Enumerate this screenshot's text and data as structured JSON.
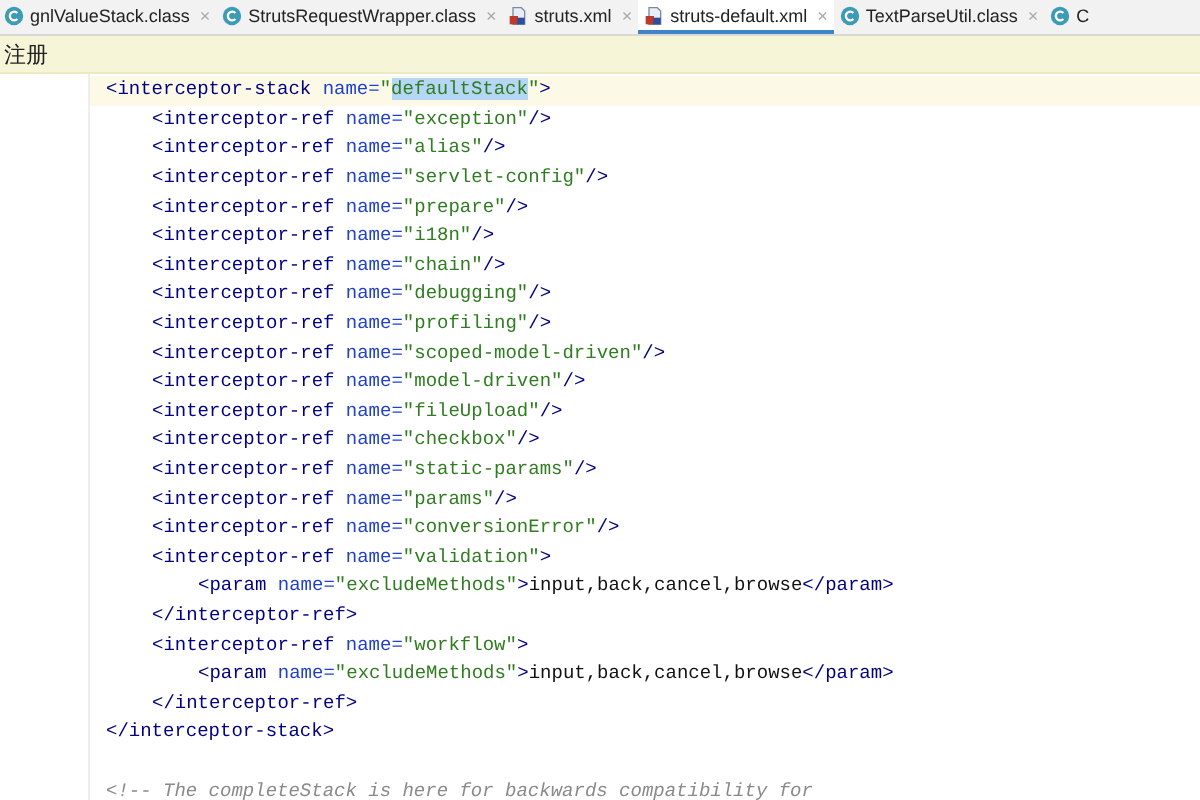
{
  "tabs": [
    {
      "label": "gnlValueStack.class",
      "kind": "class",
      "close": "×",
      "selected": false
    },
    {
      "label": "StrutsRequestWrapper.class",
      "kind": "class",
      "close": "×",
      "selected": false
    },
    {
      "label": "struts.xml",
      "kind": "xml",
      "close": "×",
      "selected": false
    },
    {
      "label": "struts-default.xml",
      "kind": "xml",
      "close": "×",
      "selected": true
    },
    {
      "label": "TextParseUtil.class",
      "kind": "class",
      "close": "×",
      "selected": false
    },
    {
      "label": "C",
      "kind": "class",
      "selected": false
    }
  ],
  "notice": {
    "text": "注册"
  },
  "code": [
    {
      "kind": "element",
      "current": true,
      "tokens": [
        {
          "kind": "tag",
          "text": "<interceptor-stack"
        },
        {
          "kind": "attr",
          "text": "name="
        },
        {
          "kind": "value",
          "text": "\""
        },
        {
          "kind": "value",
          "text": "defaultStack",
          "highlighted": true
        },
        {
          "kind": "value",
          "text": "\""
        },
        {
          "kind": "tag",
          "text": ">"
        }
      ],
      "children": [
        {
          "tokens": [
            {
              "kind": "tag",
              "text": "<interceptor-ref"
            },
            {
              "kind": "attr",
              "text": "name="
            },
            {
              "kind": "value",
              "text": "\"exception\""
            },
            {
              "kind": "tag",
              "text": "/>"
            }
          ]
        },
        {
          "tokens": [
            {
              "kind": "tag",
              "text": "<interceptor-ref"
            },
            {
              "kind": "attr",
              "text": "name="
            },
            {
              "kind": "value",
              "text": "\"alias\""
            },
            {
              "kind": "tag",
              "text": "/>"
            }
          ]
        },
        {
          "tokens": [
            {
              "kind": "tag",
              "text": "<interceptor-ref"
            },
            {
              "kind": "attr",
              "text": "name="
            },
            {
              "kind": "value",
              "text": "\"servlet-config\""
            },
            {
              "kind": "tag",
              "text": "/>"
            }
          ]
        },
        {
          "tokens": [
            {
              "kind": "tag",
              "text": "<interceptor-ref"
            },
            {
              "kind": "attr",
              "text": "name="
            },
            {
              "kind": "value",
              "text": "\"prepare\""
            },
            {
              "kind": "tag",
              "text": "/>"
            }
          ]
        },
        {
          "tokens": [
            {
              "kind": "tag",
              "text": "<interceptor-ref"
            },
            {
              "kind": "attr",
              "text": "name="
            },
            {
              "kind": "value",
              "text": "\"i18n\""
            },
            {
              "kind": "tag",
              "text": "/>"
            }
          ]
        },
        {
          "tokens": [
            {
              "kind": "tag",
              "text": "<interceptor-ref"
            },
            {
              "kind": "attr",
              "text": "name="
            },
            {
              "kind": "value",
              "text": "\"chain\""
            },
            {
              "kind": "tag",
              "text": "/>"
            }
          ]
        },
        {
          "tokens": [
            {
              "kind": "tag",
              "text": "<interceptor-ref"
            },
            {
              "kind": "attr",
              "text": "name="
            },
            {
              "kind": "value",
              "text": "\"debugging\""
            },
            {
              "kind": "tag",
              "text": "/>"
            }
          ]
        },
        {
          "tokens": [
            {
              "kind": "tag",
              "text": "<interceptor-ref"
            },
            {
              "kind": "attr",
              "text": "name="
            },
            {
              "kind": "value",
              "text": "\"profiling\""
            },
            {
              "kind": "tag",
              "text": "/>"
            }
          ]
        },
        {
          "tokens": [
            {
              "kind": "tag",
              "text": "<interceptor-ref"
            },
            {
              "kind": "attr",
              "text": "name="
            },
            {
              "kind": "value",
              "text": "\"scoped-model-driven\""
            },
            {
              "kind": "tag",
              "text": "/>"
            }
          ]
        },
        {
          "tokens": [
            {
              "kind": "tag",
              "text": "<interceptor-ref"
            },
            {
              "kind": "attr",
              "text": "name="
            },
            {
              "kind": "value",
              "text": "\"model-driven\""
            },
            {
              "kind": "tag",
              "text": "/>"
            }
          ]
        },
        {
          "tokens": [
            {
              "kind": "tag",
              "text": "<interceptor-ref"
            },
            {
              "kind": "attr",
              "text": "name="
            },
            {
              "kind": "value",
              "text": "\"fileUpload\""
            },
            {
              "kind": "tag",
              "text": "/>"
            }
          ]
        },
        {
          "tokens": [
            {
              "kind": "tag",
              "text": "<interceptor-ref"
            },
            {
              "kind": "attr",
              "text": "name="
            },
            {
              "kind": "value",
              "text": "\"checkbox\""
            },
            {
              "kind": "tag",
              "text": "/>"
            }
          ]
        },
        {
          "tokens": [
            {
              "kind": "tag",
              "text": "<interceptor-ref"
            },
            {
              "kind": "attr",
              "text": "name="
            },
            {
              "kind": "value",
              "text": "\"static-params\""
            },
            {
              "kind": "tag",
              "text": "/>"
            }
          ]
        },
        {
          "tokens": [
            {
              "kind": "tag",
              "text": "<interceptor-ref"
            },
            {
              "kind": "attr",
              "text": "name="
            },
            {
              "kind": "value",
              "text": "\"params\""
            },
            {
              "kind": "tag",
              "text": "/>"
            }
          ]
        },
        {
          "tokens": [
            {
              "kind": "tag",
              "text": "<interceptor-ref"
            },
            {
              "kind": "attr",
              "text": "name="
            },
            {
              "kind": "value",
              "text": "\"conversionError\""
            },
            {
              "kind": "tag",
              "text": "/>"
            }
          ]
        },
        {
          "tokens": [
            {
              "kind": "tag",
              "text": "<interceptor-ref"
            },
            {
              "kind": "attr",
              "text": "name="
            },
            {
              "kind": "value",
              "text": "\"validation\""
            },
            {
              "kind": "tag",
              "text": ">"
            }
          ],
          "children": [
            {
              "tokens": [
                {
                  "kind": "tag",
                  "text": "<param"
                },
                {
                  "kind": "attr",
                  "text": "name="
                },
                {
                  "kind": "value",
                  "text": "\"excludeMethods\""
                },
                {
                  "kind": "tag",
                  "text": ">"
                },
                {
                  "kind": "text",
                  "text": "input,back,cancel,browse"
                },
                {
                  "kind": "tag",
                  "text": "</param>"
                }
              ]
            }
          ],
          "end": [
            {
              "kind": "tag",
              "text": "</interceptor-ref>"
            }
          ]
        },
        {
          "tokens": [
            {
              "kind": "tag",
              "text": "<interceptor-ref"
            },
            {
              "kind": "attr",
              "text": "name="
            },
            {
              "kind": "value",
              "text": "\"workflow\""
            },
            {
              "kind": "tag",
              "text": ">"
            }
          ],
          "children": [
            {
              "tokens": [
                {
                  "kind": "tag",
                  "text": "<param"
                },
                {
                  "kind": "attr",
                  "text": "name="
                },
                {
                  "kind": "value",
                  "text": "\"excludeMethods\""
                },
                {
                  "kind": "tag",
                  "text": ">"
                },
                {
                  "kind": "text",
                  "text": "input,back,cancel,browse"
                },
                {
                  "kind": "tag",
                  "text": "</param>"
                }
              ]
            }
          ],
          "end": [
            {
              "kind": "tag",
              "text": "</interceptor-ref>"
            }
          ]
        }
      ],
      "end": [
        {
          "kind": "tag",
          "text": "</interceptor-stack>"
        }
      ]
    },
    {
      "kind": "blank"
    },
    {
      "kind": "comment",
      "tokens": [
        {
          "kind": "comment",
          "text": "<!-- The completeStack is here for backwards compatibility for"
        }
      ]
    }
  ]
}
